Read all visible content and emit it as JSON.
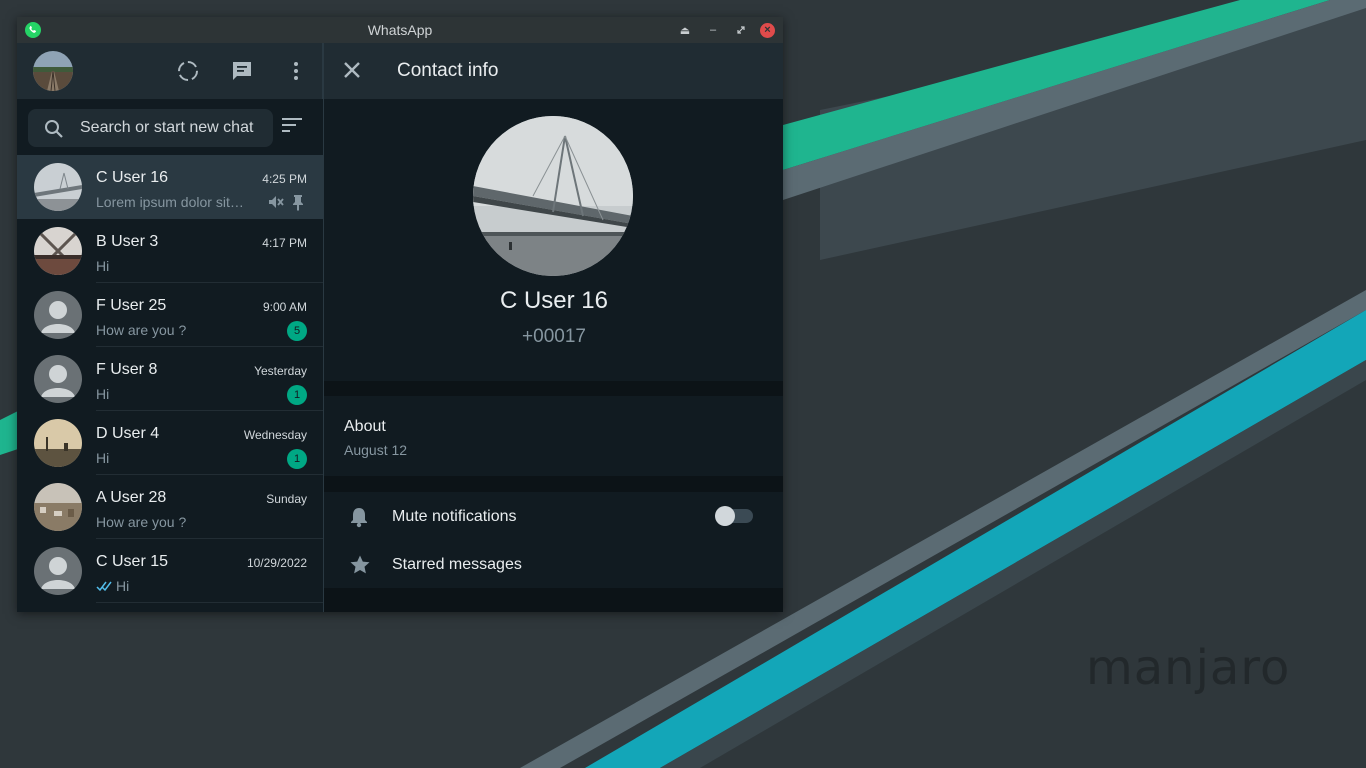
{
  "colors": {
    "accent": "#00a884",
    "panel": "#111b21",
    "header": "#202c33",
    "close_button": "#e04b4b",
    "read_tick": "#53bdeb"
  },
  "desktop": {
    "watermark": "manjaro"
  },
  "window": {
    "title": "WhatsApp",
    "controls": [
      "eject-icon",
      "minimize-icon",
      "restore-icon",
      "close-icon"
    ]
  },
  "sidebar": {
    "header_icons": [
      "status-icon",
      "new-chat-icon",
      "menu-icon"
    ],
    "search": {
      "placeholder": "Search or start new chat",
      "value": ""
    },
    "chats": [
      {
        "name": "C User 16",
        "time": "4:25 PM",
        "message": "Lorem ipsum dolor sit amet",
        "muted": true,
        "pinned": true,
        "active": true
      },
      {
        "name": "B User 3",
        "time": "4:17 PM",
        "message": "Hi"
      },
      {
        "name": "F User 25",
        "time": "9:00 AM",
        "message": "How are you ?",
        "unread": "5"
      },
      {
        "name": "F User 8",
        "time": "Yesterday",
        "message": "Hi",
        "unread": "1"
      },
      {
        "name": "D User 4",
        "time": "Wednesday",
        "message": "Hi",
        "unread": "1"
      },
      {
        "name": "A User 28",
        "time": "Sunday",
        "message": "How are you ?"
      },
      {
        "name": "C User 15",
        "time": "10/29/2022",
        "message": "Hi",
        "read_receipt": true
      }
    ]
  },
  "contact_info": {
    "title": "Contact info",
    "name": "C User 16",
    "phone": "+00017",
    "about": {
      "label": "About",
      "value": "August 12"
    },
    "mute": {
      "label": "Mute notifications",
      "enabled": false
    },
    "starred": {
      "label": "Starred messages"
    }
  }
}
